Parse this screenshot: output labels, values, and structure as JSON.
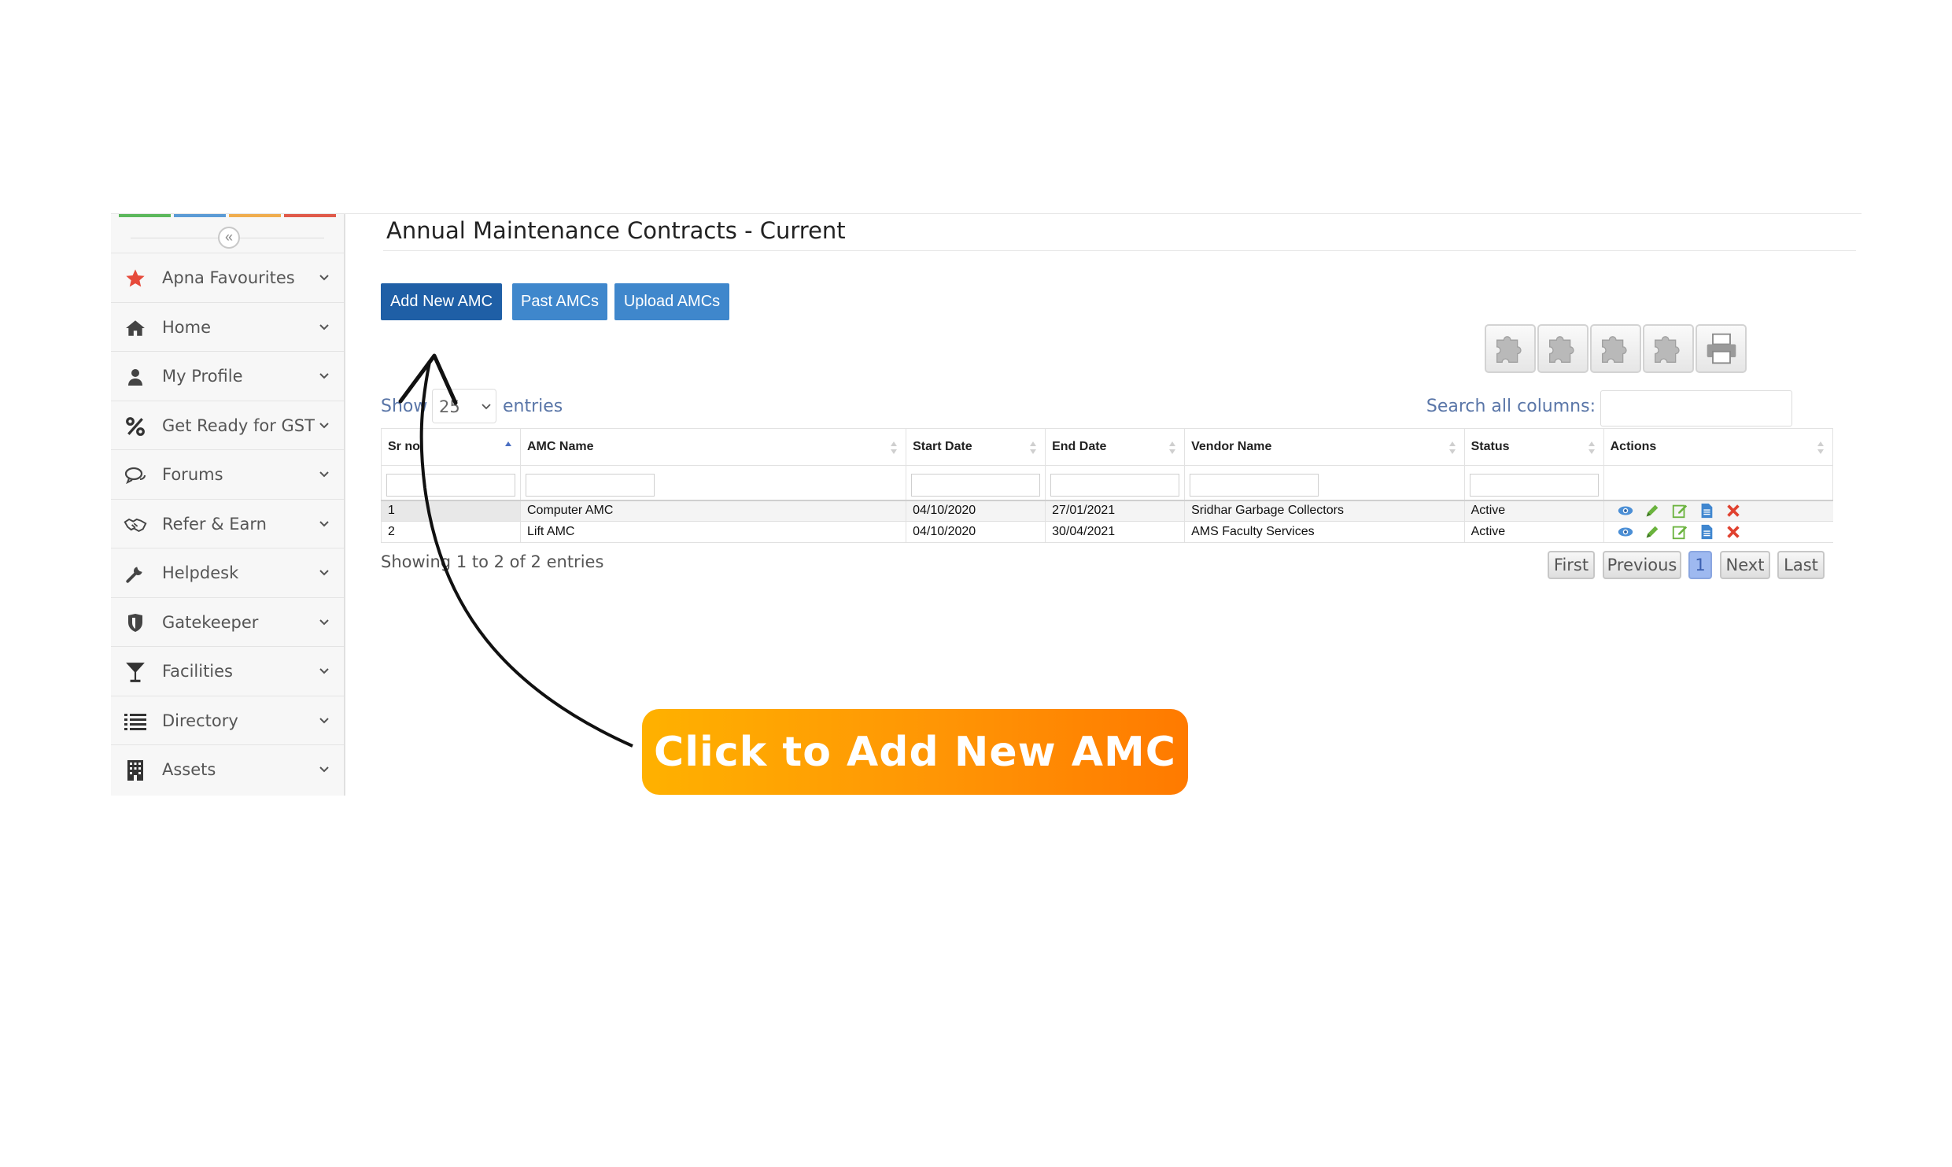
{
  "page": {
    "title": "Annual Maintenance Contracts - Current"
  },
  "sidebar": {
    "collapse_glyph": "«",
    "items": [
      {
        "label": "Apna Favourites",
        "icon": "star-icon"
      },
      {
        "label": "Home",
        "icon": "home-icon"
      },
      {
        "label": "My Profile",
        "icon": "user-icon"
      },
      {
        "label": "Get Ready for GST",
        "icon": "percent-icon"
      },
      {
        "label": "Forums",
        "icon": "chat-icon"
      },
      {
        "label": "Refer & Earn",
        "icon": "handshake-icon"
      },
      {
        "label": "Helpdesk",
        "icon": "wrench-icon"
      },
      {
        "label": "Gatekeeper",
        "icon": "shield-icon"
      },
      {
        "label": "Facilities",
        "icon": "cocktail-icon"
      },
      {
        "label": "Directory",
        "icon": "list-icon"
      },
      {
        "label": "Assets",
        "icon": "building-icon"
      }
    ]
  },
  "toolbar": {
    "add_label": "Add New AMC",
    "past_label": "Past AMCs",
    "upload_label": "Upload AMCs"
  },
  "table_controls": {
    "show_label": "Show",
    "page_size": "25",
    "entries_label": "entries",
    "search_label": "Search all columns:"
  },
  "table": {
    "columns": [
      "Sr no",
      "AMC Name",
      "Start Date",
      "End Date",
      "Vendor Name",
      "Status",
      "Actions"
    ],
    "rows": [
      {
        "sr": "1",
        "name": "Computer AMC",
        "start": "04/10/2020",
        "end": "27/01/2021",
        "vendor": "Sridhar Garbage Collectors",
        "status": "Active"
      },
      {
        "sr": "2",
        "name": "Lift AMC",
        "start": "04/10/2020",
        "end": "30/04/2021",
        "vendor": "AMS Faculty Services",
        "status": "Active"
      }
    ]
  },
  "footer": {
    "info": "Showing 1 to 2 of 2 entries",
    "pagination": {
      "first": "First",
      "previous": "Previous",
      "current": "1",
      "next": "Next",
      "last": "Last"
    }
  },
  "annotation": {
    "callout_text": "Click to Add New AMC"
  },
  "colors": {
    "primary_button": "#1f5fa6",
    "secondary_button": "#3f87cc",
    "callout_start": "#ffb100",
    "callout_end": "#ff7a00",
    "star": "#e64a3b"
  }
}
